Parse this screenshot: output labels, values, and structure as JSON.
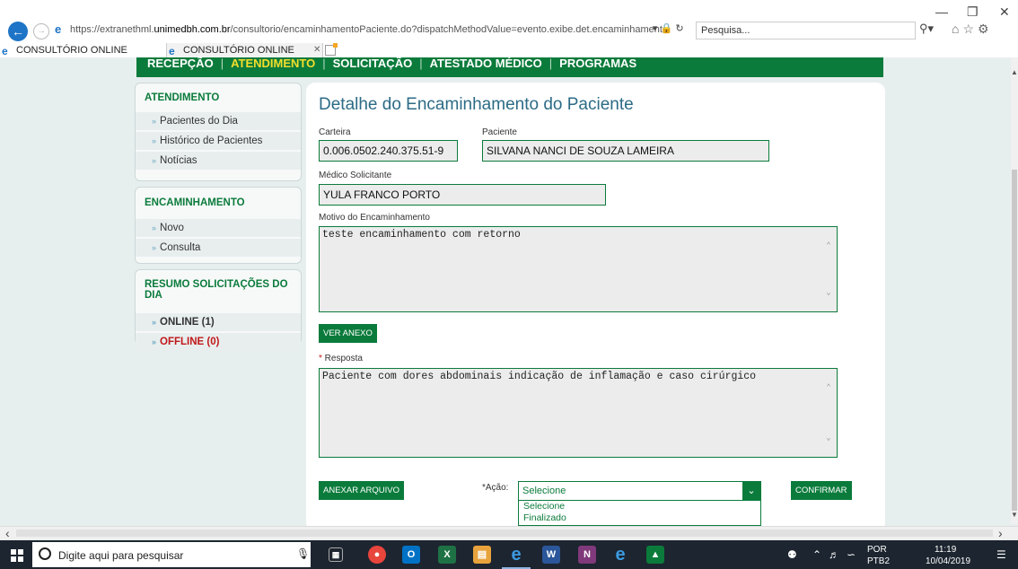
{
  "browser": {
    "url_prefix": "https://extranethml.",
    "url_domain": "unimedbh.com.br",
    "url_path": "/consultorio/encaminhamentoPaciente.do?dispatchMethodValue=evento.exibe.det.encaminhamento",
    "url_tools": "▾ 🔒 ↻",
    "search_placeholder": "Pesquisa...",
    "tabs": [
      {
        "label": "CONSULTÓRIO ONLINE"
      },
      {
        "label": "CONSULTÓRIO ONLINE"
      }
    ]
  },
  "topnav": {
    "items": [
      "RECEPÇÃO",
      "ATENDIMENTO",
      "SOLICITAÇÃO",
      "ATESTADO MÉDICO",
      "PROGRAMAS"
    ],
    "active": "ATENDIMENTO"
  },
  "sidebar": {
    "atendimento": {
      "title": "ATENDIMENTO",
      "items": [
        "Pacientes do Dia",
        "Histórico de Pacientes",
        "Notícias"
      ]
    },
    "encaminhamento": {
      "title": "ENCAMINHAMENTO",
      "items": [
        "Novo",
        "Consulta"
      ]
    },
    "resumo": {
      "title": "RESUMO SOLICITAÇÕES DO DIA",
      "items": [
        "ONLINE (1)",
        "OFFLINE (0)"
      ]
    }
  },
  "form": {
    "title": "Detalhe do Encaminhamento do Paciente",
    "carteira_label": "Carteira",
    "carteira_value": "0.006.0502.240.375.51-9",
    "paciente_label": "Paciente",
    "paciente_value": "SILVANA NANCI DE SOUZA LAMEIRA",
    "medico_label": "Médico Solicitante",
    "medico_value": "YULA FRANCO PORTO",
    "motivo_label": "Motivo do Encaminhamento",
    "motivo_value": "teste encaminhamento com retorno",
    "ver_anexo": "VER ANEXO",
    "resposta_required": "*",
    "resposta_label": " Resposta",
    "resposta_value": "Paciente com dores abdominais indicação de inflamação e caso cirúrgico",
    "anexar_arquivo": "ANEXAR ARQUIVO",
    "acao_label": "*Ação:",
    "acao_selected": "Selecione",
    "acao_options": [
      "Selecione",
      "Finalizado"
    ],
    "confirmar": "CONFIRMAR"
  },
  "taskbar": {
    "search_placeholder": "Digite aqui para pesquisar",
    "lang_top": "POR",
    "lang_bottom": "PTB2",
    "time": "11:19",
    "date": "10/04/2019"
  },
  "colors": {
    "brand_green": "#0b7b3b",
    "active_nav": "#f3de2c",
    "title_blue": "#2c6b86",
    "offline_red": "#c0181a"
  }
}
